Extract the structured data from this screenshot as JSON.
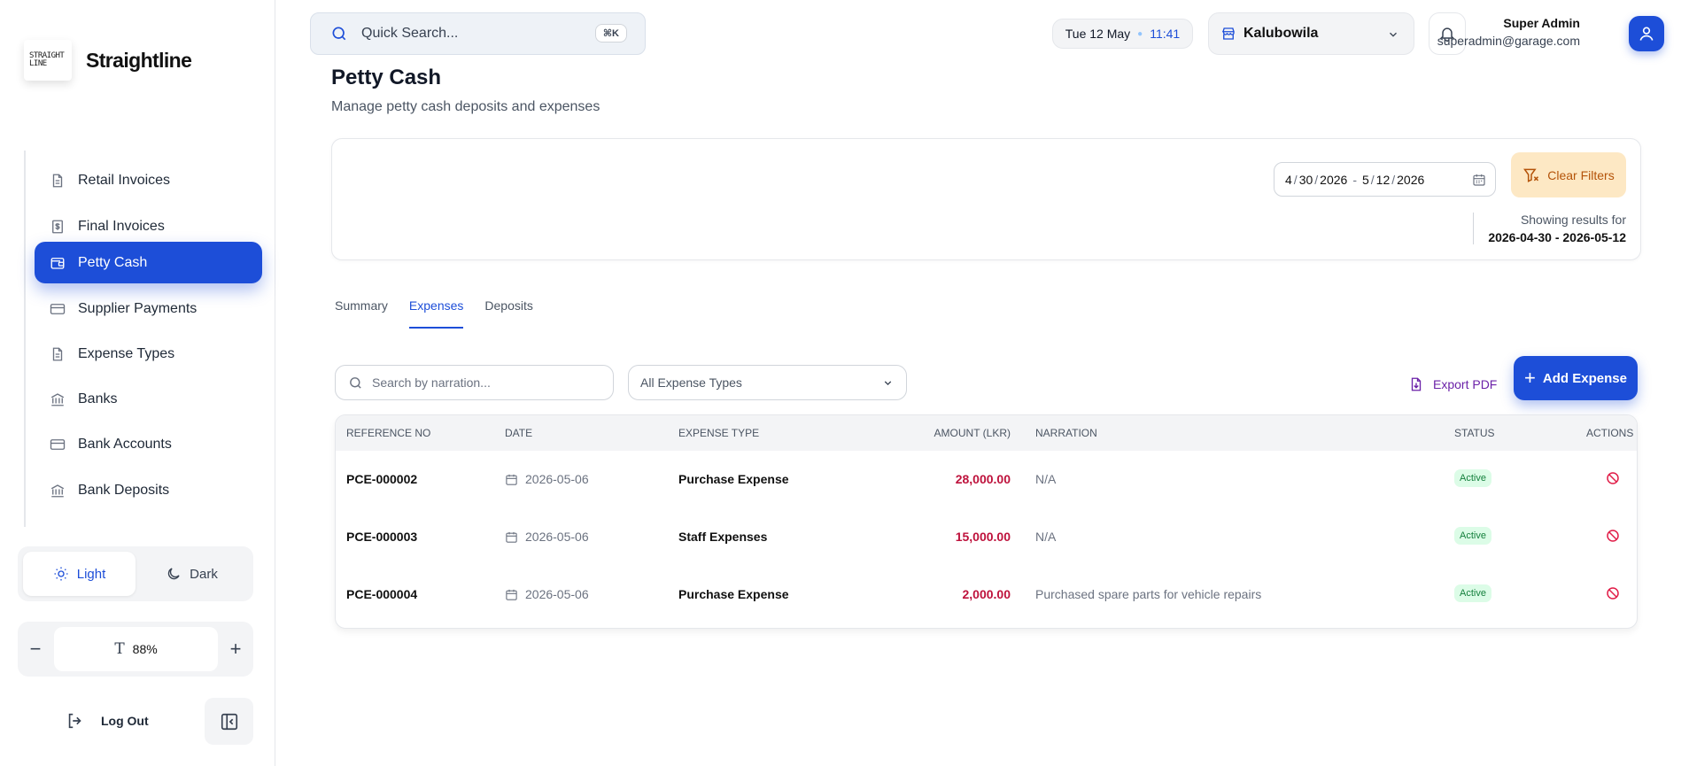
{
  "brand": {
    "logo_line1": "STRAIGHT",
    "logo_line2": "LINE",
    "name": "Straightline"
  },
  "sidebar": {
    "items": [
      {
        "label": "Retail Invoices",
        "icon": "document-icon"
      },
      {
        "label": "Final Invoices",
        "icon": "dollar-document-icon"
      },
      {
        "label": "Petty Cash",
        "icon": "wallet-icon",
        "active": true
      },
      {
        "label": "Supplier Payments",
        "icon": "credit-card-icon"
      },
      {
        "label": "Expense Types",
        "icon": "document-icon"
      },
      {
        "label": "Banks",
        "icon": "bank-icon"
      },
      {
        "label": "Bank Accounts",
        "icon": "credit-card-icon"
      },
      {
        "label": "Bank Deposits",
        "icon": "bank-icon"
      }
    ],
    "theme": {
      "light": "Light",
      "dark": "Dark"
    },
    "zoom": {
      "value": "88%",
      "minus": "−",
      "plus": "+"
    },
    "logout": "Log Out"
  },
  "header": {
    "search_placeholder": "Quick Search...",
    "search_shortcut": "⌘K",
    "date": "Tue 12 May",
    "time": "11:41",
    "branch": "Kalubowila",
    "user_name": "Super Admin",
    "user_email": "superadmin@garage.com"
  },
  "page": {
    "title": "Petty Cash",
    "subtitle": "Manage petty cash deposits and expenses"
  },
  "filters": {
    "start": {
      "m": "4",
      "d": "30",
      "y": "2026"
    },
    "end": {
      "m": "5",
      "d": "12",
      "y": "2026"
    },
    "clear_label": "Clear Filters",
    "showing_label": "Showing results for",
    "showing_range": "2026-04-30 - 2026-05-12"
  },
  "tabs": [
    {
      "label": "Summary"
    },
    {
      "label": "Expenses",
      "active": true
    },
    {
      "label": "Deposits"
    }
  ],
  "toolbar": {
    "narration_placeholder": "Search by narration...",
    "expense_type": "All Expense Types",
    "export_label": "Export PDF",
    "add_label": "Add Expense"
  },
  "table": {
    "headers": {
      "ref": "REFERENCE NO",
      "date": "DATE",
      "type": "EXPENSE TYPE",
      "amount": "AMOUNT (LKR)",
      "narration": "NARRATION",
      "status": "STATUS",
      "actions": "ACTIONS"
    },
    "rows": [
      {
        "ref": "PCE-000002",
        "date": "2026-05-06",
        "type": "Purchase Expense",
        "amount": "28,000.00",
        "narration": "N/A",
        "status": "Active"
      },
      {
        "ref": "PCE-000003",
        "date": "2026-05-06",
        "type": "Staff Expenses",
        "amount": "15,000.00",
        "narration": "N/A",
        "status": "Active"
      },
      {
        "ref": "PCE-000004",
        "date": "2026-05-06",
        "type": "Purchase Expense",
        "amount": "2,000.00",
        "narration": "Purchased spare parts for vehicle repairs",
        "status": "Active"
      }
    ]
  },
  "colors": {
    "primary": "#1d4ed8",
    "amount": "#be123c",
    "status_bg": "#dcfce7",
    "status_text": "#15803d",
    "clear_bg": "#fde8c4",
    "cancel_icon": "#e11d48"
  }
}
